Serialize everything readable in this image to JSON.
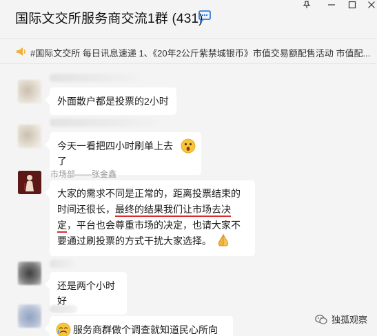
{
  "header": {
    "title": "国际文交所服务商交流1群 (431)"
  },
  "announcement": {
    "text": "#国际文交所 每日讯息速递 1、《20年2公斤紫禁城银币》市值交易额配售活动 市值配..."
  },
  "messages": [
    {
      "sender": "",
      "text": "外面散户都是投票的2小时"
    },
    {
      "sender": "",
      "text": "今天一看把四小时刷单上去了"
    },
    {
      "sender": "市场部——张金鑫",
      "text_a": "大家的需求不同是正常的，距离投票结束的时间还很长，",
      "text_underlined": "最终的结果我们让市场去决定",
      "text_b": "，平台也会尊重市场的决定，也请大家不要通过刷投票的方式干扰大家选择。"
    },
    {
      "sender": "",
      "text": "还是两个小时好"
    },
    {
      "sender": "",
      "text": "服务商群做个调查就知道民心所向了"
    }
  ],
  "watermark": {
    "text": "独孤观察"
  },
  "colors": {
    "background": "#f4f4f4",
    "bubble": "#ffffff",
    "underline": "#d92b2b",
    "accent": "#2f7ee0"
  }
}
